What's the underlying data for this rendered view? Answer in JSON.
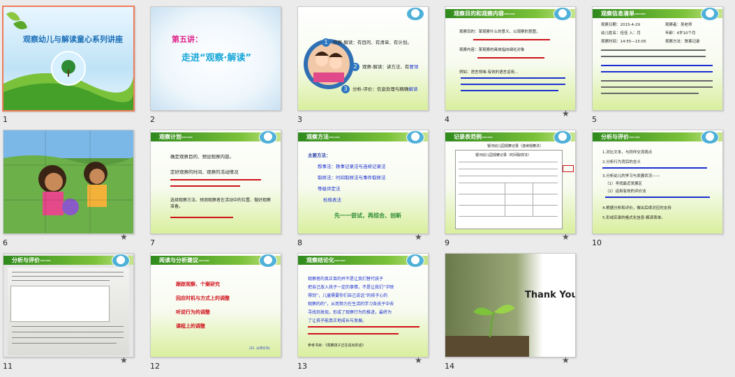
{
  "slides": [
    {
      "number": "1",
      "title": "观察幼儿与解读童心系列讲座"
    },
    {
      "number": "2",
      "subtitle": "第五讲：",
      "title": "走进“观察·解读”"
    },
    {
      "number": "3",
      "items": [
        "观察-解读：有目的、有清单、有计划。",
        "观察-解读：讲方法、有",
        "分析-评价：信息处理与精确"
      ],
      "items_link": [
        "要领",
        "解读"
      ],
      "badges": [
        "1",
        "2",
        "3"
      ]
    },
    {
      "number": "4",
      "header": "观察目的和观察内容——",
      "lines": [
        "观察目的：某观察什么的意义，以观察的意图，",
        "观察内容：某观察的具体指向细化对象",
        "例如：语言领域-有效的语言运用…"
      ]
    },
    {
      "number": "5",
      "header": "观察信息清单——",
      "lines": [
        "观察日期：2015-4-29",
        "观察者：吴老师",
        "幼儿姓名：佳佳 入：月",
        "年龄：4岁10个月",
        "观察时间：14:55—15:05",
        "观察方法：轶事记录"
      ]
    },
    {
      "number": "6"
    },
    {
      "number": "7",
      "header": "观察计划——",
      "lines": [
        "确定观察目的、预设观察内容。",
        "定好观察的时间、观察的活动情况",
        "选择观察方法、预测观察者在活动中的位置、做好观察准备。"
      ]
    },
    {
      "number": "8",
      "header": "观察方法——",
      "lead": "主要方法：",
      "lines": [
        "叙事法：轶事记录法与连续记录法",
        "取样法：时间取样法与事件取样法",
        "等级评定法",
        "检核表法"
      ],
      "footer": "先一一尝试，再综合、创新"
    },
    {
      "number": "9",
      "header": "记录表范例——",
      "caption": "银河幼儿园观察记录（连续观察法）",
      "table_title": "银河幼儿园观察记录（时间取样法）"
    },
    {
      "number": "10",
      "header": "分析与评价——",
      "lines": [
        "1.对比文本，与同伴交流观点",
        "2.分析行为背后的含义",
        "3.分析幼儿的学习与发展状况——",
        "（1）寻找最近发展区",
        "（2）运用有效的评价法",
        "4.根据分析和评价，做出后续对应的支持",
        "5.形成实录的格式化信息-解读表单。"
      ]
    },
    {
      "number": "11",
      "header": "分析与评价——"
    },
    {
      "number": "12",
      "header": "阅读与分析建议——",
      "lines": [
        "跟踪观察、个案研究",
        "回应时机与方式上的调整",
        "听说行为的调整",
        "课程上的调整"
      ],
      "footer": "（21. 以评价为）"
    },
    {
      "number": "13",
      "header": "观察结论化——",
      "lines": [
        "观察者的真正目的并不是让我们替代孩子",
        "把自己放入孩子一定的事情，不是让我们“字映",
        "得到”，儿童需要你们自己说话“的孩子心的",
        "观察的的”，从而努力在生活的学习各孩子中去",
        "寻找到发现，形成了观察行为的推进，最终为",
        "了让孩子能真正地成长与发展。"
      ],
      "footer": "参考书目：《观察孩子正在说出的话》"
    },
    {
      "number": "14",
      "text": "Thank You!"
    }
  ],
  "colors": {
    "accent_green": "#5ab52a",
    "selected_border": "#f07c5a",
    "text_red": "#d0101a",
    "text_blue": "#1a2dd0"
  }
}
